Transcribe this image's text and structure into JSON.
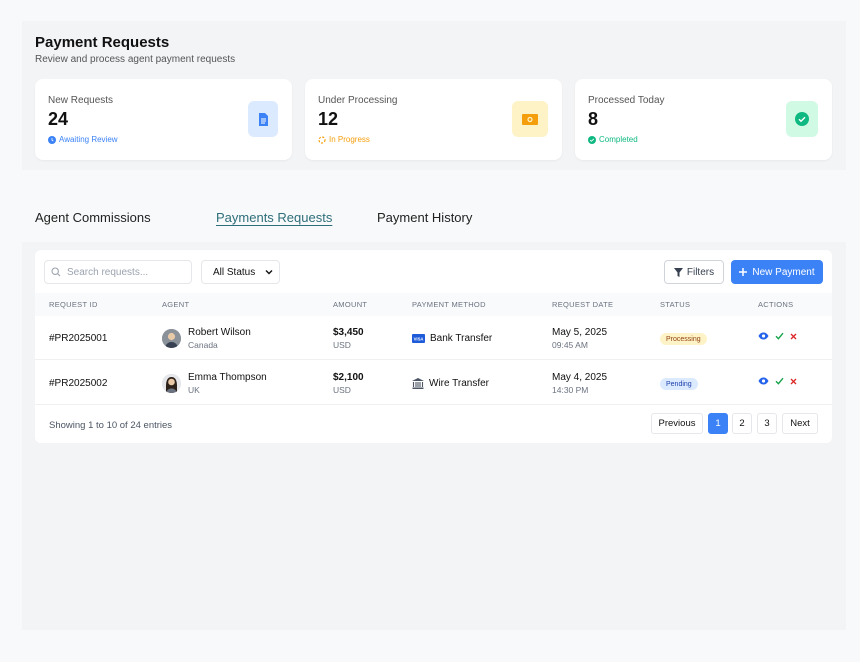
{
  "header": {
    "title": "Payment Requests",
    "subtitle": "Review and process agent payment requests"
  },
  "cards": [
    {
      "label": "New Requests",
      "value": "24",
      "status": "Awaiting Review",
      "status_color": "#3b82f6",
      "icon": "document-icon",
      "icon_bg": "#dbeafe",
      "icon_color": "#3b82f6"
    },
    {
      "label": "Under Processing",
      "value": "12",
      "status": "In Progress",
      "status_color": "#f59e0b",
      "icon": "money-icon",
      "icon_bg": "#fef3c7",
      "icon_color": "#f59e0b"
    },
    {
      "label": "Processed Today",
      "value": "8",
      "status": "Completed",
      "status_color": "#10b981",
      "icon": "check-circle-icon",
      "icon_bg": "#d1fae5",
      "icon_color": "#10b981"
    }
  ],
  "tabs": [
    {
      "label": "Agent Commissions",
      "active": false
    },
    {
      "label": "Payments Requests",
      "active": true
    },
    {
      "label": "Payment History",
      "active": false
    }
  ],
  "toolbar": {
    "search_placeholder": "Search requests...",
    "status_filter": "All Status",
    "filters_label": "Filters",
    "new_payment_label": "New Payment"
  },
  "table": {
    "headers": [
      "REQUEST ID",
      "AGENT",
      "AMOUNT",
      "PAYMENT METHOD",
      "REQUEST DATE",
      "STATUS",
      "ACTIONS"
    ],
    "rows": [
      {
        "id": "#PR2025001",
        "agent": "Robert Wilson",
        "country": "Canada",
        "amount": "$3,450",
        "currency": "USD",
        "method": "Bank Transfer",
        "method_icon": "card-icon",
        "date": "May 5, 2025",
        "time": "09:45 AM",
        "status": "Processing"
      },
      {
        "id": "#PR2025002",
        "agent": "Emma Thompson",
        "country": "UK",
        "amount": "$2,100",
        "currency": "USD",
        "method": "Wire Transfer",
        "method_icon": "bank-icon",
        "date": "May 4, 2025",
        "time": "14:30 PM",
        "status": "Pending"
      }
    ]
  },
  "pagination": {
    "info": "Showing 1 to 10 of 24 entries",
    "previous": "Previous",
    "pages": [
      "1",
      "2",
      "3"
    ],
    "current": "1",
    "next": "Next"
  },
  "colors": {
    "primary": "#3b82f6",
    "active_tab": "#2e6e7a"
  }
}
